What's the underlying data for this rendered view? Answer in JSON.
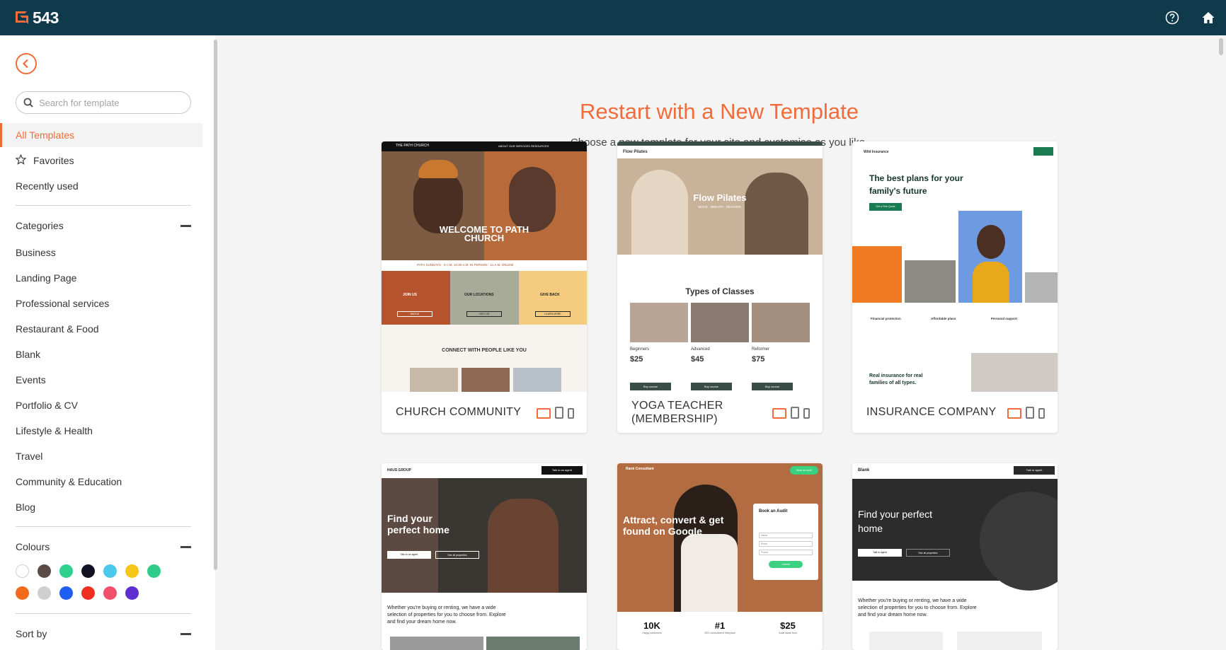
{
  "app": {
    "logo_text": "543"
  },
  "topbar": {
    "help_icon": "help-circle-icon",
    "home_icon": "home-icon"
  },
  "sidebar": {
    "search_placeholder": "Search for template",
    "nav": [
      {
        "label": "All Templates",
        "active": true
      },
      {
        "label": "Favorites",
        "icon": "star-icon"
      },
      {
        "label": "Recently used"
      }
    ],
    "categories_heading": "Categories",
    "categories": [
      "Business",
      "Landing Page",
      "Professional services",
      "Restaurant & Food",
      "Blank",
      "Events",
      "Portfolio & CV",
      "Lifestyle & Health",
      "Travel",
      "Community & Education",
      "Blog"
    ],
    "colours_heading": "Colours",
    "colours": [
      "#ffffff",
      "#5a4b45",
      "#2fcf8c",
      "#111122",
      "#4cc8ea",
      "#f5c518",
      "#2ecc88",
      "#f26b1d",
      "#cfcfcf",
      "#1f5ef0",
      "#ef2f1f",
      "#f0506a",
      "#5d2fd0"
    ],
    "sort_heading": "Sort by"
  },
  "main": {
    "title": "Restart with a New Template",
    "subtitle": "Choose a new template for your site and customise as you like.",
    "cards": [
      {
        "name": "CHURCH COMMUNITY",
        "thumb": {
          "nav": "THE PATH CHURCH",
          "nav_links": "ABOUT   OUR SERVICES   RESOURCES",
          "hero": "WELCOME TO PATH CHURCH",
          "strip": "PATH SUNDAYS · 9 A.M. 10:30 A.M. IN PERSON · 11 A.M. ONLINE",
          "panels": [
            "JOIN US",
            "OUR LOCATIONS",
            "GIVE BACK"
          ],
          "panel_buttons": [
            "WATCH",
            "VISIT US",
            "LEARN MORE"
          ],
          "section": "CONNECT WITH PEOPLE LIKE YOU"
        }
      },
      {
        "name": "YOGA TEACHER (MEMBERSHIP)",
        "thumb": {
          "nav": "Flow Pilates",
          "hero": "Flow Pilates",
          "hero_sub": "MOVE · BREATH · RESTORE",
          "section": "Types of Classes",
          "classes": [
            {
              "label": "Beginners",
              "price": "$25",
              "button": "Buy course"
            },
            {
              "label": "Advanced",
              "price": "$45",
              "button": "Buy course"
            },
            {
              "label": "Reformer",
              "price": "$75",
              "button": "Buy course"
            }
          ]
        }
      },
      {
        "name": "INSURANCE COMPANY",
        "thumb": {
          "nav": "Wild Insurance",
          "hero": "The best plans for your family's future",
          "cta": "Get a Free Quote",
          "features": [
            "Financial protection",
            "Affordable plans",
            "Personal support"
          ],
          "bottom": "Real insurance for real families of all types."
        }
      },
      {
        "name": "",
        "thumb": {
          "nav": "HAUS GROUP",
          "nav_cta": "Talk to an agent",
          "hero": "Find your perfect home",
          "buttons": [
            "Talk to an agent",
            "See all properties"
          ],
          "body": "Whether you're buying or renting, we have a wide selection of properties for you to choose from. Explore and find your dream home now."
        }
      },
      {
        "name": "",
        "thumb": {
          "nav": "Rank Consultant",
          "nav_cta": "Book an Audit",
          "hero": "Attract, convert & get found on Google",
          "form_title": "Book an Audit",
          "form_fields": [
            "Name",
            "Email",
            "Phone"
          ],
          "form_button": "Submit",
          "stats": [
            {
              "value": "10K",
              "label": "Happy customers"
            },
            {
              "value": "#1",
              "label": "SEO consultant in Maryland"
            },
            {
              "value": "$25",
              "label": "Audit starts from"
            }
          ]
        }
      },
      {
        "name": "",
        "thumb": {
          "nav": "Blank",
          "nav_cta": "Talk to agent",
          "hero": "Find your perfect home",
          "buttons": [
            "Talk to agent",
            "See all properties"
          ],
          "body": "Whether you're buying or renting, we have a wide selection of properties for you to choose from. Explore and find your dream home now."
        }
      }
    ]
  }
}
